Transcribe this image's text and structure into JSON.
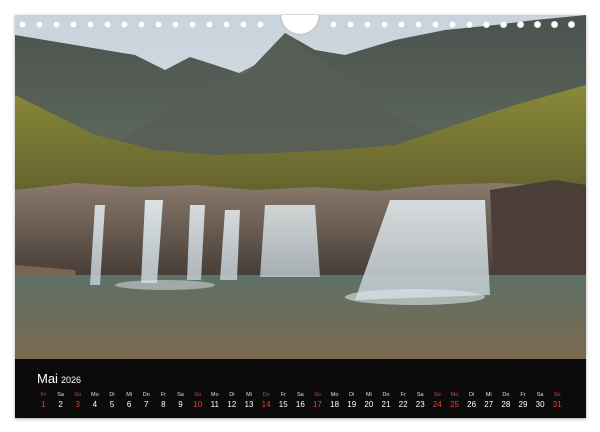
{
  "calendar": {
    "month": "Mai",
    "year": "2026",
    "days": [
      {
        "dn": "Fr",
        "num": "1",
        "red": true
      },
      {
        "dn": "Sa",
        "num": "2",
        "red": false
      },
      {
        "dn": "So",
        "num": "3",
        "red": true
      },
      {
        "dn": "Mo",
        "num": "4",
        "red": false
      },
      {
        "dn": "Di",
        "num": "5",
        "red": false
      },
      {
        "dn": "Mi",
        "num": "6",
        "red": false
      },
      {
        "dn": "Do",
        "num": "7",
        "red": false
      },
      {
        "dn": "Fr",
        "num": "8",
        "red": false
      },
      {
        "dn": "Sa",
        "num": "9",
        "red": false
      },
      {
        "dn": "So",
        "num": "10",
        "red": true
      },
      {
        "dn": "Mo",
        "num": "11",
        "red": false
      },
      {
        "dn": "Di",
        "num": "12",
        "red": false
      },
      {
        "dn": "Mi",
        "num": "13",
        "red": false
      },
      {
        "dn": "Do",
        "num": "14",
        "red": true
      },
      {
        "dn": "Fr",
        "num": "15",
        "red": false
      },
      {
        "dn": "Sa",
        "num": "16",
        "red": false
      },
      {
        "dn": "So",
        "num": "17",
        "red": true
      },
      {
        "dn": "Mo",
        "num": "18",
        "red": false
      },
      {
        "dn": "Di",
        "num": "19",
        "red": false
      },
      {
        "dn": "Mi",
        "num": "20",
        "red": false
      },
      {
        "dn": "Do",
        "num": "21",
        "red": false
      },
      {
        "dn": "Fr",
        "num": "22",
        "red": false
      },
      {
        "dn": "Sa",
        "num": "23",
        "red": false
      },
      {
        "dn": "So",
        "num": "24",
        "red": true
      },
      {
        "dn": "Mo",
        "num": "25",
        "red": true
      },
      {
        "dn": "Di",
        "num": "26",
        "red": false
      },
      {
        "dn": "Mi",
        "num": "27",
        "red": false
      },
      {
        "dn": "Do",
        "num": "28",
        "red": false
      },
      {
        "dn": "Fr",
        "num": "29",
        "red": false
      },
      {
        "dn": "Sa",
        "num": "30",
        "red": false
      },
      {
        "dn": "So",
        "num": "31",
        "red": true
      }
    ]
  },
  "colors": {
    "holiday": "#e0442f",
    "bar": "#0b0b0b",
    "text": "#ffffff"
  },
  "photo": {
    "subject": "mountain-waterfall-landscape"
  }
}
